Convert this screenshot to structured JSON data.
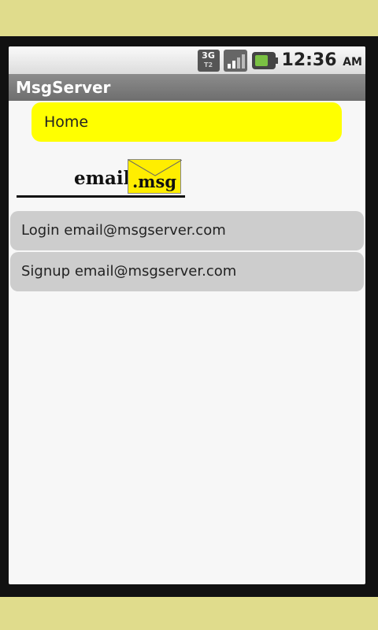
{
  "status_bar": {
    "network": "3G",
    "network_sub": "T2",
    "time": "12:36",
    "ampm": "AM"
  },
  "title_bar": {
    "title": "MsgServer"
  },
  "home_button": {
    "label": "Home"
  },
  "logo": {
    "prefix": "email",
    "suffix": ".msg"
  },
  "list": [
    {
      "label": "Login email@msgserver.com"
    },
    {
      "label": "Signup email@msgserver.com"
    }
  ],
  "colors": {
    "page_background": "#e0dc8c",
    "accent_yellow": "#ffff00",
    "list_item": "#cdcdcd",
    "title_bar": "#7a7a7a"
  }
}
